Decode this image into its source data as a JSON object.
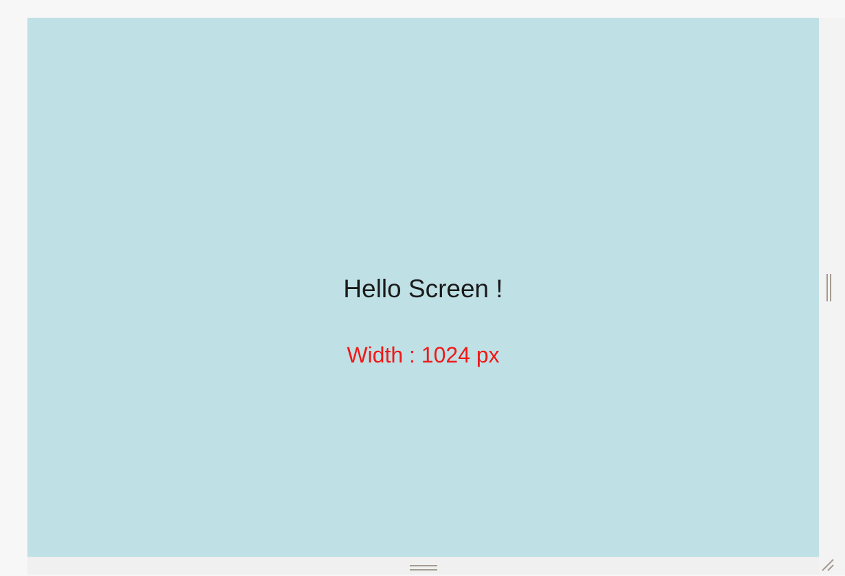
{
  "screen": {
    "heading": "Hello Screen !",
    "width_text": "Width : 1024 px"
  },
  "colors": {
    "viewport_background": "#bfe1e5",
    "heading": "#1a1a1a",
    "width_text": "#f01818",
    "handle": "#a39a90"
  },
  "icons": {
    "right_handle": "vertical-resize-handle-icon",
    "bottom_handle": "horizontal-resize-handle-icon",
    "corner_handle": "corner-resize-grip-icon"
  }
}
